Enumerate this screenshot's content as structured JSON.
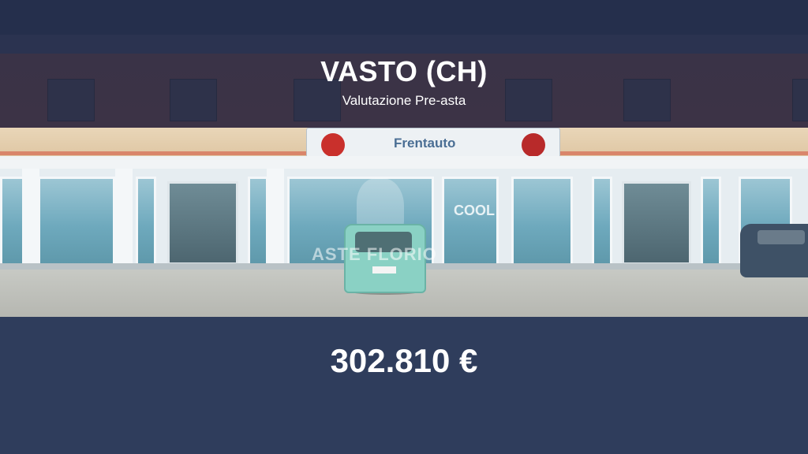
{
  "header": {
    "title": "VASTO (CH)",
    "subtitle": "Valutazione Pre-asta"
  },
  "photo": {
    "sign_text": "Frentauto",
    "watermark": "ASTE FLORIO",
    "store_banner": "COOL"
  },
  "price": {
    "value": "302.810 €"
  },
  "colors": {
    "background": "#2f3d5c",
    "text": "#ffffff"
  }
}
